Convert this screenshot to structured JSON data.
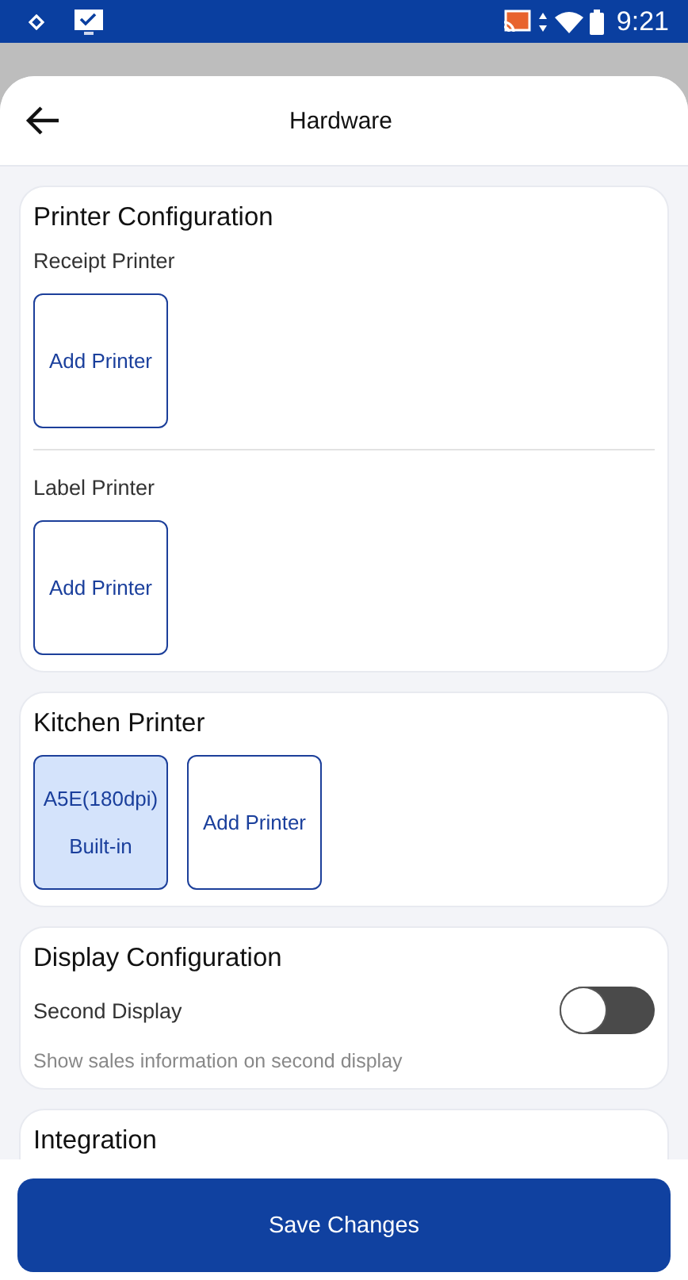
{
  "status_bar": {
    "time": "9:21"
  },
  "header": {
    "title": "Hardware"
  },
  "sections": [
    {
      "kind": "groups",
      "title": "Printer Configuration",
      "groups": [
        {
          "label": "Receipt Printer",
          "tiles": [
            {
              "kind": "add",
              "label": "Add Printer"
            }
          ]
        },
        {
          "label": "Label Printer",
          "tiles": [
            {
              "kind": "add",
              "label": "Add Printer"
            }
          ]
        }
      ]
    },
    {
      "kind": "tiles",
      "title": "Kitchen Printer",
      "tiles": [
        {
          "kind": "device",
          "name": "A5E(180dpi)",
          "sub": "Built-in",
          "selected": true
        },
        {
          "kind": "add",
          "label": "Add Printer"
        }
      ]
    },
    {
      "kind": "toggle",
      "title": "Display Configuration",
      "label": "Second Display",
      "description": "Show sales information on second display",
      "on": false
    },
    {
      "kind": "plain",
      "title": "Integration"
    }
  ],
  "footer": {
    "button": "Save Changes"
  }
}
